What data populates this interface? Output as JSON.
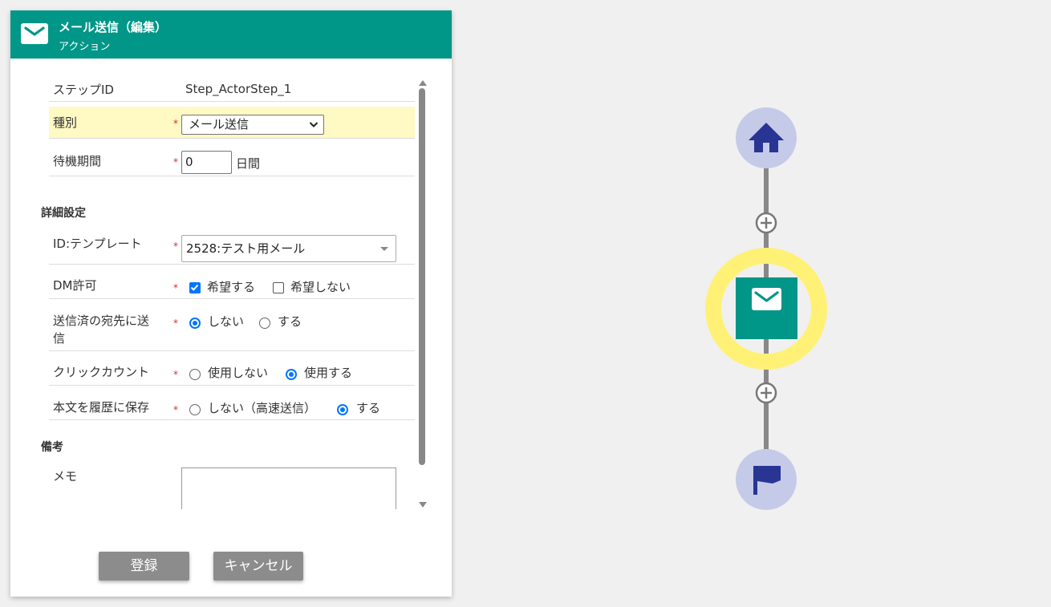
{
  "header": {
    "title": "メール送信（編集）",
    "subtitle": "アクション",
    "icon": "mail-icon",
    "color": "#009688"
  },
  "form": {
    "step_id": {
      "label": "ステップID",
      "value": "Step_ActorStep_1"
    },
    "type": {
      "label": "種別",
      "required": "*",
      "value": "メール送信"
    },
    "wait": {
      "label": "待機期間",
      "required": "*",
      "value": "0",
      "unit": "日間"
    },
    "section_detail": "詳細設定",
    "template": {
      "label": "ID:テンプレート",
      "required": "*",
      "value": "2528:テスト用メール"
    },
    "dm": {
      "label": "DM許可",
      "required": "*",
      "options": [
        {
          "label": "希望する",
          "checked": true
        },
        {
          "label": "希望しない",
          "checked": false
        }
      ]
    },
    "resend": {
      "label_line1": "送信済の宛先に送",
      "label_line2": "信",
      "required": "*",
      "options": [
        {
          "label": "しない",
          "selected": true
        },
        {
          "label": "する",
          "selected": false
        }
      ]
    },
    "click_count": {
      "label": "クリックカウント",
      "required": "*",
      "options": [
        {
          "label": "使用しない",
          "selected": false
        },
        {
          "label": "使用する",
          "selected": true
        }
      ]
    },
    "save_history": {
      "label": "本文を履歴に保存",
      "required": "*",
      "options": [
        {
          "label": "しない（高速送信）",
          "selected": false
        },
        {
          "label": "する",
          "selected": true
        }
      ]
    },
    "section_notes": "備考",
    "memo": {
      "label": "メモ",
      "value": ""
    }
  },
  "buttons": {
    "register": "登録",
    "cancel": "キャンセル"
  },
  "flow": {
    "nodes": [
      {
        "type": "start",
        "icon": "home-icon"
      },
      {
        "type": "add",
        "icon": "plus-circle-icon"
      },
      {
        "type": "action",
        "icon": "mail-icon",
        "selected": true
      },
      {
        "type": "add",
        "icon": "plus-circle-icon"
      },
      {
        "type": "end",
        "icon": "flag-icon"
      }
    ],
    "colors": {
      "node_bg": "#c5cae9",
      "node_icon": "#283593",
      "action": "#009688",
      "highlight": "#fff176",
      "line": "#888888"
    }
  }
}
